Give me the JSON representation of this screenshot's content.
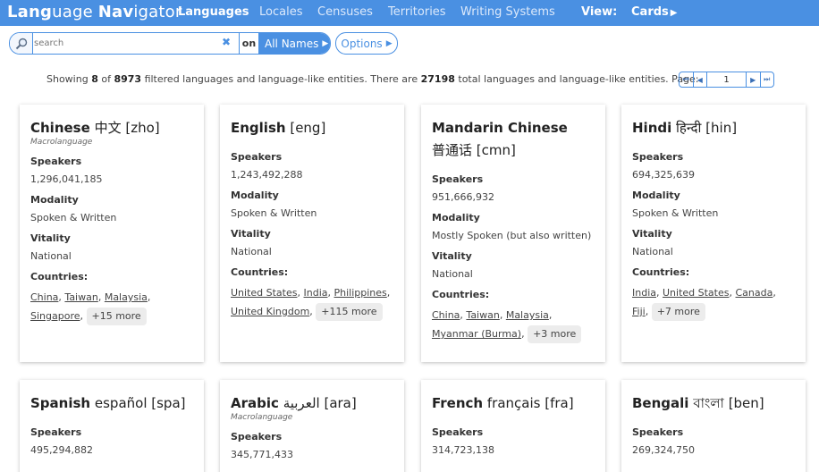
{
  "brand": {
    "first_bold": "Lang",
    "first_light": "uage ",
    "second_bold": "Nav",
    "second_light": "igator"
  },
  "nav": {
    "tabs": [
      {
        "label": "Languages",
        "active": true
      },
      {
        "label": "Locales",
        "active": false
      },
      {
        "label": "Censuses",
        "active": false
      },
      {
        "label": "Territories",
        "active": false
      },
      {
        "label": "Writing Systems",
        "active": false
      }
    ],
    "view_label": "View:",
    "view_value": "Cards"
  },
  "search": {
    "placeholder": "search",
    "value": "",
    "on_label": "on",
    "field_value": "All Names",
    "options_label": "Options"
  },
  "status": {
    "showing_pre": "Showing ",
    "shown": "8",
    "of": " of ",
    "filtered": "8973",
    "mid": " filtered languages and language-like entities. There are ",
    "total": "27198",
    "post": " total languages and language-like entities. Page:",
    "page": "1"
  },
  "cards": [
    {
      "name": "Chinese",
      "native": "中文",
      "code": "[zho]",
      "scope": "Macrolanguage",
      "speakers_label": "Speakers",
      "speakers": "1,296,041,185",
      "modality_label": "Modality",
      "modality": "Spoken & Written",
      "vitality_label": "Vitality",
      "vitality": "National",
      "countries_label": "Countries:",
      "countries": [
        "China",
        "Taiwan",
        "Malaysia",
        "Singapore"
      ],
      "more": "+15 more"
    },
    {
      "name": "English",
      "native": "",
      "code": "[eng]",
      "scope": "",
      "speakers_label": "Speakers",
      "speakers": "1,243,492,288",
      "modality_label": "Modality",
      "modality": "Spoken & Written",
      "vitality_label": "Vitality",
      "vitality": "National",
      "countries_label": "Countries:",
      "countries": [
        "United States",
        "India",
        "Philippines",
        "United Kingdom"
      ],
      "more": "+115 more"
    },
    {
      "name": "Mandarin Chinese",
      "native": "普通话",
      "code": "[cmn]",
      "scope": "",
      "speakers_label": "Speakers",
      "speakers": "951,666,932",
      "modality_label": "Modality",
      "modality": "Mostly Spoken (but also written)",
      "vitality_label": "Vitality",
      "vitality": "National",
      "countries_label": "Countries:",
      "countries": [
        "China",
        "Taiwan",
        "Malaysia",
        "Myanmar (Burma)"
      ],
      "more": "+3 more"
    },
    {
      "name": "Hindi",
      "native": "हिन्दी",
      "code": "[hin]",
      "scope": "",
      "speakers_label": "Speakers",
      "speakers": "694,325,639",
      "modality_label": "Modality",
      "modality": "Spoken & Written",
      "vitality_label": "Vitality",
      "vitality": "National",
      "countries_label": "Countries:",
      "countries": [
        "India",
        "United States",
        "Canada",
        "Fiji"
      ],
      "more": "+7 more"
    },
    {
      "name": "Spanish",
      "native": "español",
      "code": "[spa]",
      "scope": "",
      "speakers_label": "Speakers",
      "speakers": "495,294,882"
    },
    {
      "name": "Arabic",
      "native": "العربية",
      "code": "[ara]",
      "scope": "Macrolanguage",
      "speakers_label": "Speakers",
      "speakers": "345,771,433"
    },
    {
      "name": "French",
      "native": "français",
      "code": "[fra]",
      "scope": "",
      "speakers_label": "Speakers",
      "speakers": "314,723,138"
    },
    {
      "name": "Bengali",
      "native": "বাংলা",
      "code": "[ben]",
      "scope": "",
      "speakers_label": "Speakers",
      "speakers": "269,324,750"
    }
  ]
}
